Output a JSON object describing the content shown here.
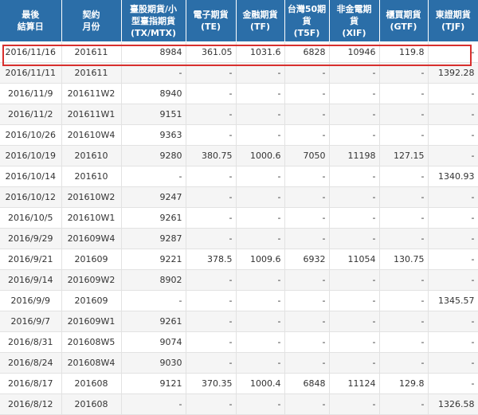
{
  "header": [
    {
      "lines": [
        "最後",
        "結算日"
      ]
    },
    {
      "lines": [
        "契約",
        "月份"
      ]
    },
    {
      "lines": [
        "臺股期貨/小",
        "型臺指期貨",
        "(TX/MTX)"
      ]
    },
    {
      "lines": [
        "電子期貨",
        "(TE)"
      ]
    },
    {
      "lines": [
        "金融期貨",
        "(TF)"
      ]
    },
    {
      "lines": [
        "台灣50期",
        "貨",
        "(T5F)"
      ]
    },
    {
      "lines": [
        "非金電期",
        "貨",
        "(XIF)"
      ]
    },
    {
      "lines": [
        "櫃買期貨",
        "(GTF)"
      ]
    },
    {
      "lines": [
        "東證期貨",
        "(TJF)"
      ]
    }
  ],
  "rows": [
    [
      "2016/11/16",
      "201611",
      "8984",
      "361.05",
      "1031.6",
      "6828",
      "10946",
      "119.8",
      "-"
    ],
    [
      "2016/11/11",
      "201611",
      "-",
      "-",
      "-",
      "-",
      "-",
      "-",
      "1392.28"
    ],
    [
      "2016/11/9",
      "201611W2",
      "8940",
      "-",
      "-",
      "-",
      "-",
      "-",
      "-"
    ],
    [
      "2016/11/2",
      "201611W1",
      "9151",
      "-",
      "-",
      "-",
      "-",
      "-",
      "-"
    ],
    [
      "2016/10/26",
      "201610W4",
      "9363",
      "-",
      "-",
      "-",
      "-",
      "-",
      "-"
    ],
    [
      "2016/10/19",
      "201610",
      "9280",
      "380.75",
      "1000.6",
      "7050",
      "11198",
      "127.15",
      "-"
    ],
    [
      "2016/10/14",
      "201610",
      "-",
      "-",
      "-",
      "-",
      "-",
      "-",
      "1340.93"
    ],
    [
      "2016/10/12",
      "201610W2",
      "9247",
      "-",
      "-",
      "-",
      "-",
      "-",
      "-"
    ],
    [
      "2016/10/5",
      "201610W1",
      "9261",
      "-",
      "-",
      "-",
      "-",
      "-",
      "-"
    ],
    [
      "2016/9/29",
      "201609W4",
      "9287",
      "-",
      "-",
      "-",
      "-",
      "-",
      "-"
    ],
    [
      "2016/9/21",
      "201609",
      "9221",
      "378.5",
      "1009.6",
      "6932",
      "11054",
      "130.75",
      "-"
    ],
    [
      "2016/9/14",
      "201609W2",
      "8902",
      "-",
      "-",
      "-",
      "-",
      "-",
      "-"
    ],
    [
      "2016/9/9",
      "201609",
      "-",
      "-",
      "-",
      "-",
      "-",
      "-",
      "1345.57"
    ],
    [
      "2016/9/7",
      "201609W1",
      "9261",
      "-",
      "-",
      "-",
      "-",
      "-",
      "-"
    ],
    [
      "2016/8/31",
      "201608W5",
      "9074",
      "-",
      "-",
      "-",
      "-",
      "-",
      "-"
    ],
    [
      "2016/8/24",
      "201608W4",
      "9030",
      "-",
      "-",
      "-",
      "-",
      "-",
      "-"
    ],
    [
      "2016/8/17",
      "201608",
      "9121",
      "370.35",
      "1000.4",
      "6848",
      "11124",
      "129.8",
      "-"
    ],
    [
      "2016/8/12",
      "201608",
      "-",
      "-",
      "-",
      "-",
      "-",
      "-",
      "1326.58"
    ]
  ],
  "highlight_color": "#d8302e",
  "header_bg": "#2b6ea8"
}
